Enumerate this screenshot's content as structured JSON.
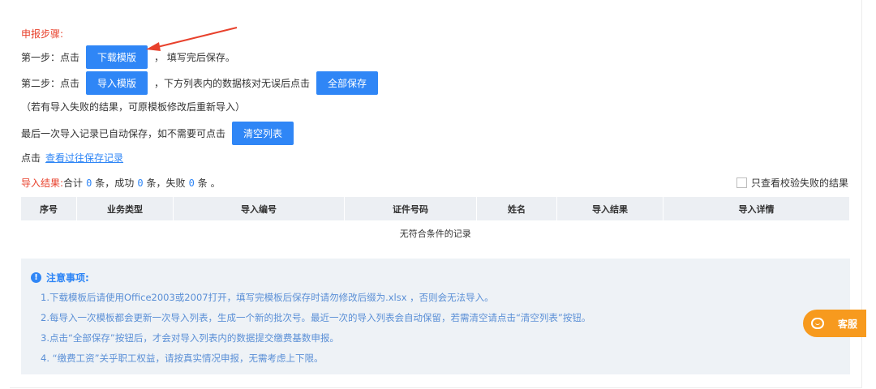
{
  "steps": {
    "title": "申报步骤:",
    "step1_prefix": "第一步：点击",
    "download_button": "下载模版",
    "step1_suffix": "，  填写完后保存。",
    "step2_prefix": "第二步：点击",
    "import_button": "导入模版",
    "step2_middle": "，下方列表内的数据核对无误后点击",
    "save_all_button": "全部保存",
    "note_retry": "（若有导入失败的结果，可原模板修改后重新导入）",
    "auto_save_text": "最后一次导入记录已自动保存，如不需要可点击",
    "clear_button": "清空列表",
    "history_prefix": "点击",
    "history_link": "查看过往保存记录"
  },
  "results": {
    "label": "导入结果:",
    "total_text": "合计",
    "total": "0",
    "total_unit": "条，成功",
    "success": "0",
    "success_unit": "条，失败",
    "fail": "0",
    "fail_unit": "条 。",
    "only_failed_label": "只查看校验失败的结果"
  },
  "table": {
    "columns": [
      "序号",
      "业务类型",
      "导入编号",
      "证件号码",
      "姓名",
      "导入结果",
      "导入详情"
    ],
    "empty_text": "无符合条件的记录"
  },
  "notes": {
    "title": "注意事项:",
    "items": [
      "1.下载模板后请使用Office2003或2007打开，填写完模板后保存时请勿修改后缀为.xlsx ，否则会无法导入。",
      "2.每导入一次模板都会更新一次导入列表，生成一个新的批次号。最近一次的导入列表会自动保留，若需清空请点击“清空列表”按钮。",
      "3.点击“全部保存”按钮后，才会对导入列表内的数据提交缴费基数申报。",
      "4. “缴费工资”关乎职工权益，请按真实情况申报，无需考虑上下限。"
    ]
  },
  "service": {
    "label": "客服"
  },
  "colors": {
    "accent": "#2f86f6",
    "warning": "#e8412c",
    "service": "#f79a1e"
  }
}
